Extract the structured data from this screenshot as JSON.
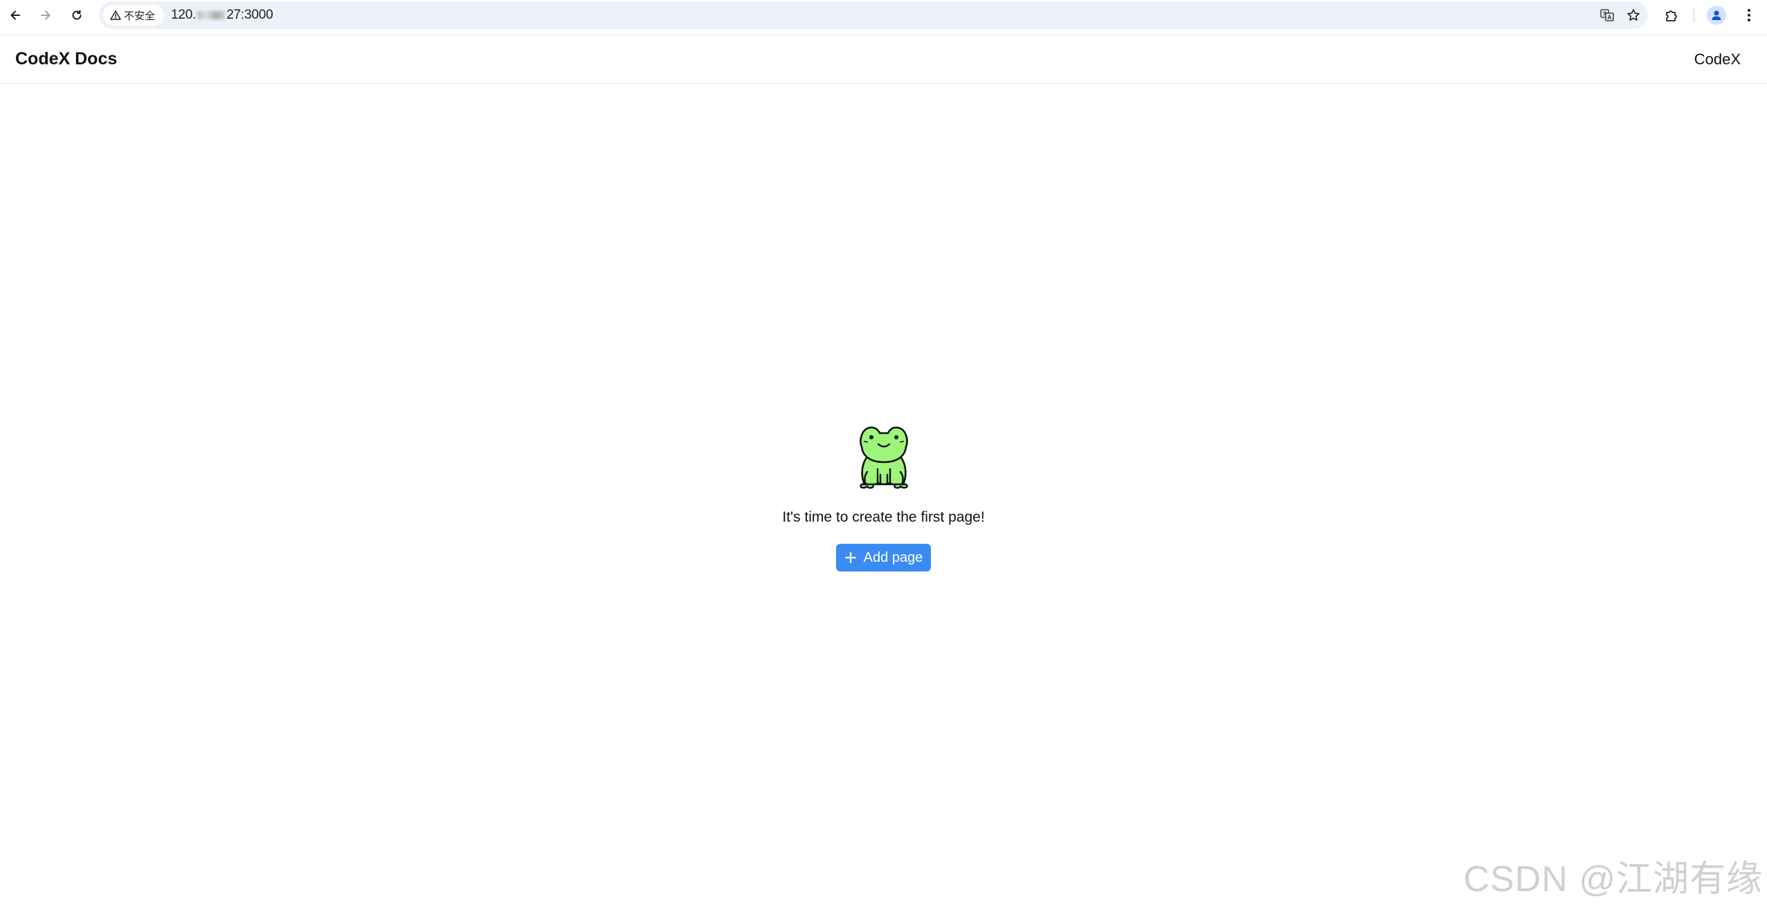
{
  "browser": {
    "security_label": "不安全",
    "url_prefix": "120.",
    "url_suffix": "27:3000"
  },
  "app": {
    "title": "CodeX Docs",
    "header_link": "CodeX"
  },
  "empty_state": {
    "message": "It's time to create the first page!",
    "add_button_label": "Add page"
  },
  "colors": {
    "accent": "#3a8cf3",
    "frog_green": "#9df57a"
  },
  "icons": {
    "back": "arrow-left-icon",
    "forward": "arrow-right-icon",
    "reload": "reload-icon",
    "warning": "warning-triangle-icon",
    "translate": "translate-icon",
    "bookmark": "star-icon",
    "extensions": "puzzle-icon",
    "profile": "person-icon",
    "menu": "kebab-menu-icon",
    "add": "plus-icon",
    "mascot": "frog-icon"
  },
  "watermark": "CSDN @江湖有缘"
}
